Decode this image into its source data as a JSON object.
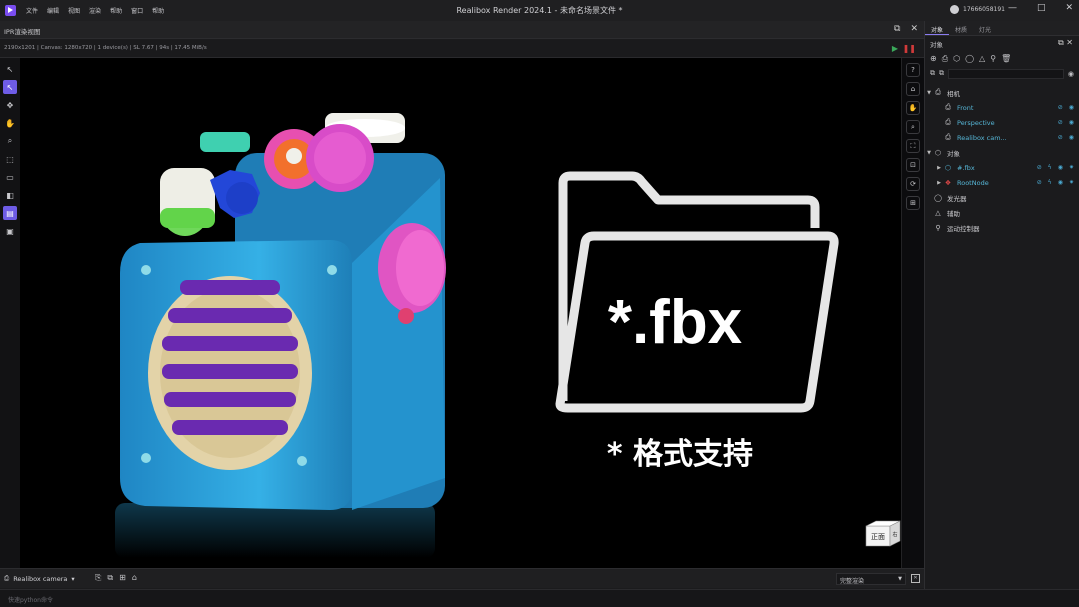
{
  "titlebar": {
    "menu": [
      "文件",
      "编辑",
      "视图",
      "渲染",
      "帮助",
      "窗口",
      "帮助"
    ],
    "title": "Realibox Render 2024.1 - 未命名场景文件 *",
    "user": "17666058191",
    "controls": [
      "—",
      "□",
      "✕"
    ]
  },
  "viewport": {
    "header_label": "IPR渲染视图",
    "stats": "2190x1201 | Canvas: 1280x720 | 1 device(s) | SL 7.67 | 94s | 17.45 MiB/s",
    "camera_label": "Realibox camera",
    "render_mode": "完整渲染",
    "overlay_filetype": "*.fbx",
    "overlay_caption": "* 格式支持",
    "viewcube_front": "正面",
    "viewcube_right": "右"
  },
  "command_placeholder": "快速python命令",
  "panel": {
    "tabs": [
      "对象",
      "材质",
      "灯光"
    ],
    "section_title": "对象",
    "tree": {
      "cameras_label": "相机",
      "cameras": [
        "Front",
        "Perspective",
        "Realibox cam..."
      ],
      "objects_label": "对象",
      "objects": [
        "#.fbx",
        "RootNode"
      ],
      "emitter_label": "发光器",
      "helper_label": "辅助",
      "motion_label": "运动控制器"
    }
  },
  "colors": {
    "accent": "#6e5ce6",
    "tree_child": "#56b6d6",
    "play": "#3aa85a",
    "stop": "#d03a3a",
    "radio_body": "#2a9fd6",
    "speaker_grille": "#e3d3a8",
    "knob_pink": "#e85ab8",
    "knob_orange": "#f06a2a"
  }
}
